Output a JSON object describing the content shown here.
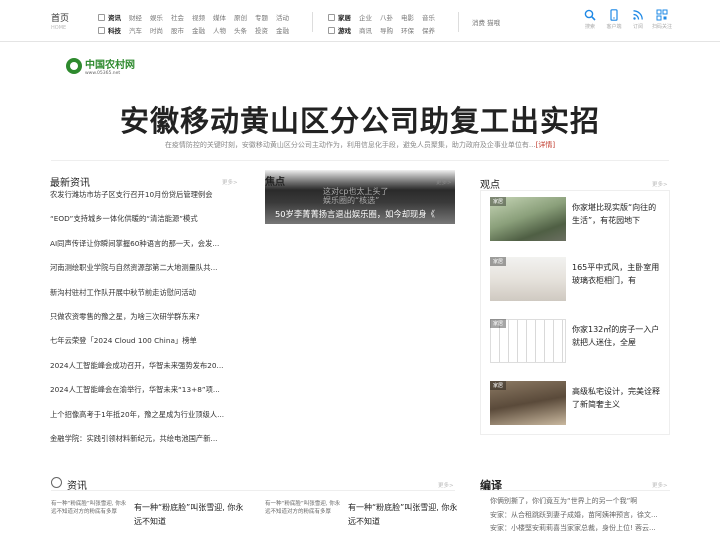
{
  "nav": {
    "home": "首页",
    "home_sub": "HOME",
    "group1_row1": [
      "资讯",
      "财经",
      "娱乐",
      "社会",
      "视频",
      "媒体",
      "原创",
      "专题",
      "活动"
    ],
    "group1_row2": [
      "科技",
      "汽车",
      "时尚",
      "股市",
      "金融",
      "人物",
      "头条",
      "投资",
      "金融"
    ],
    "group2_row1": [
      "家居",
      "企业",
      "八卦",
      "电影",
      "音乐"
    ],
    "group2_row2": [
      "游戏",
      "商讯",
      "导购",
      "环保",
      "保养"
    ],
    "hotline": "消费 猫哦",
    "tools": [
      "搜索",
      "客户端",
      "订阅",
      "扫码关注"
    ]
  },
  "logo": {
    "name": "中国农村网",
    "url_text": "www.05365.net"
  },
  "banner": {
    "title": "安徽移动黄山区分公司助复工出实招",
    "summary": "在疫情防控的关键时刻，安徽移动黄山区分公司主动作为，利用信息化手段，避免人员聚集，助力政府及企事业单位有...",
    "detail_link": "[详情]"
  },
  "latest": {
    "heading": "最新资讯",
    "more": "更多>",
    "items": [
      "农发行潍坊市坊子区支行召开10月份贷后管理例会",
      "“EOD”支持城乡一体化供暖的“清洁能源”模式",
      "AI同声传译让你瞬间掌握60种语言的那一天，会发...",
      "河南测绘职业学院与自然资源部第二大地测量队共...",
      "新沟村驻村工作队开展中秋节前走访慰问活动",
      "只做农资零售的豫之星，为啥三次研学群东来?",
      "七年云荣登「2024 Cloud 100 China」榜单",
      "2024人工智能峰会成功召开，华智未来强势发布20...",
      "2024人工智能峰会在渝举行，华智未来“13+8”项...",
      "上个招像高考于1年抵20年，豫之星成为行业顶级人...",
      "金融学院：实践引领材料新纪元，共绘电池国产新..."
    ]
  },
  "focus": {
    "label": "焦点",
    "more": "更多>",
    "ghost1": "这对cp也太上头了",
    "ghost2": "娱乐圈的“核选”",
    "caption": "50岁李菁菁扬言退出娱乐圈，如今却现身《"
  },
  "opinion": {
    "heading": "观点",
    "more": "更多>",
    "items": [
      {
        "tag": "家居",
        "text": "你家堪比现实版“向往的生活”，有花园地下"
      },
      {
        "tag": "家居",
        "text": "165平中式风，主卧室用玻璃衣柜相门，有"
      },
      {
        "tag": "家居",
        "text": "你家132㎡的房子一入户就把人迷住，全屋"
      },
      {
        "tag": "家居",
        "text": "高级私宅设计，完美诠释了新简奢主义"
      }
    ]
  },
  "zixun": {
    "heading": "资讯",
    "more": "更多>",
    "items": [
      {
        "img_alt": "有一种“粉底脸”叫张雪迎, 你永远不知道对方的粉底有多厚",
        "title": "有一种“粉底脸”叫张雪迎, 你永远不知道"
      },
      {
        "img_alt": "有一种“粉底脸”叫张雪迎, 你永远不知道对方的粉底有多厚",
        "title": "有一种“粉底脸”叫张雪迎, 你永远不知道"
      }
    ]
  },
  "bianyi": {
    "heading": "编译",
    "more": "更多>",
    "items": [
      "你俩别撕了，你们竟互为“世界上的另一个我”啊",
      "安家：从合租跳跃到妻子成婚，苗阿姨神预言，徐文...",
      "安家：小楼堅安莉莉喜当家家总裁，身份上位! 蓉云..."
    ]
  },
  "colors": {
    "logo_green": "#2e8a2e",
    "link_red": "#c0392b",
    "accent_blue": "#1e88e5"
  }
}
